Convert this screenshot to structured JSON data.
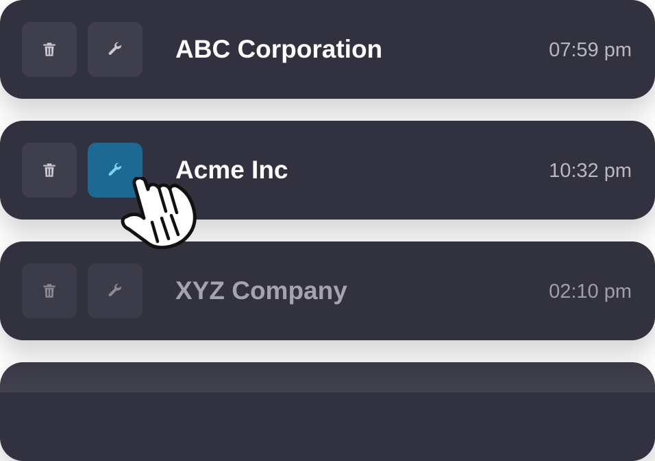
{
  "rows": [
    {
      "company": "ABC Corporation",
      "time": "07:59 pm"
    },
    {
      "company": "Acme Inc",
      "time": "10:32 pm"
    },
    {
      "company": "XYZ Company",
      "time": "02:10 pm"
    }
  ],
  "icons": {
    "delete": "trash-icon",
    "edit": "wrench-icon",
    "cursor": "hand-pointer-icon"
  },
  "colors": {
    "card_background": "#32313f",
    "button_background": "#3f3e4c",
    "active_button_background": "#1c6a93",
    "active_icon": "#7fd4f5",
    "text_primary": "#ffffff",
    "text_secondary": "#b8b8c2"
  }
}
